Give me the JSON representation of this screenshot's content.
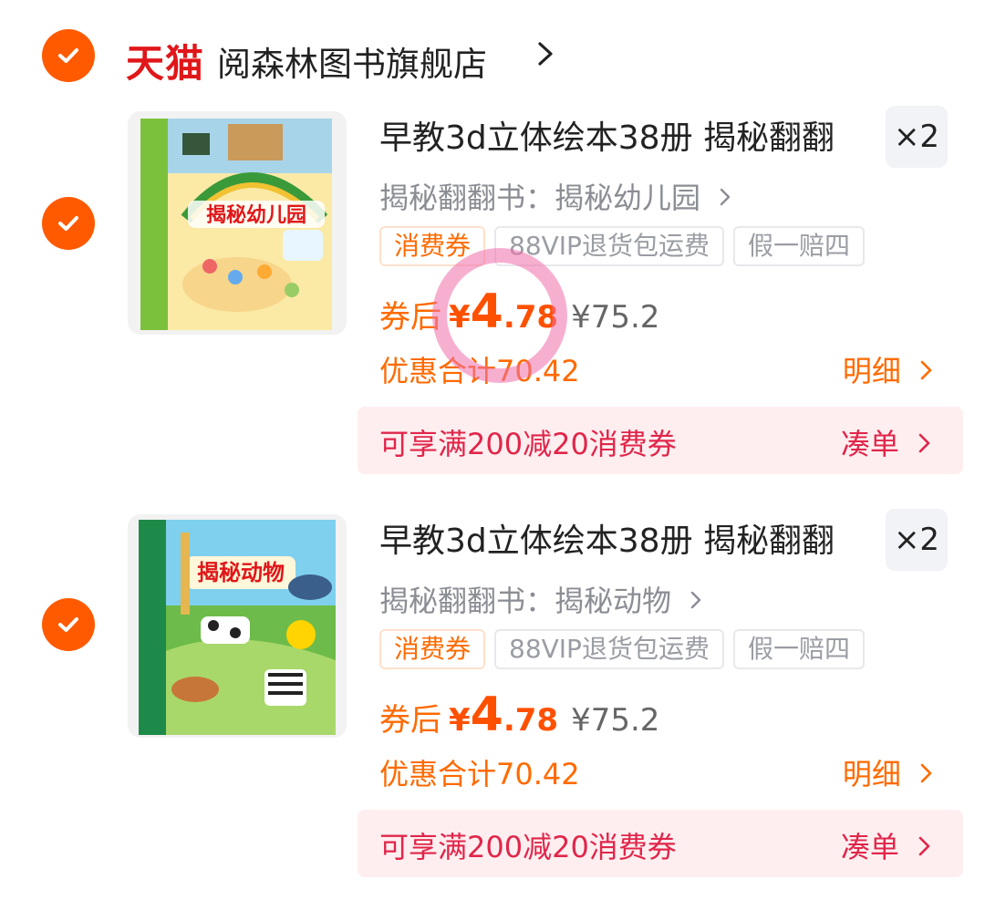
{
  "store": {
    "brand": "天猫",
    "name": "阅森林图书旗舰店",
    "selected": true
  },
  "items": [
    {
      "cover_title": "揭秘幼儿园",
      "title": "早教3d立体绘本38册 揭秘翻翻",
      "quantity": "×2",
      "sku": "揭秘翻翻书：揭秘幼儿园",
      "tags": [
        "消费券",
        "88VIP退货包运费",
        "假一赔四"
      ],
      "price_label": "券后",
      "currency": "¥",
      "price_int": "4",
      "price_dec": ".78",
      "original_price": "¥75.2",
      "discount_total": "优惠合计70.42",
      "detail_label": "明细",
      "promo_text": "可享满200减20消费券",
      "promo_action": "凑单",
      "selected": true
    },
    {
      "cover_title": "揭秘动物",
      "title": "早教3d立体绘本38册 揭秘翻翻",
      "quantity": "×2",
      "sku": "揭秘翻翻书：揭秘动物",
      "tags": [
        "消费券",
        "88VIP退货包运费",
        "假一赔四"
      ],
      "price_label": "券后",
      "currency": "¥",
      "price_int": "4",
      "price_dec": ".78",
      "original_price": "¥75.2",
      "discount_total": "优惠合计70.42",
      "detail_label": "明细",
      "promo_text": "可享满200减20消费券",
      "promo_action": "凑单",
      "selected": true
    }
  ],
  "colors": {
    "accent": "#ff5000",
    "promo_bg": "#ffeef0",
    "promo_text": "#e0264a",
    "tmall_red": "#e0171a",
    "annotation": "#f06eaa"
  }
}
